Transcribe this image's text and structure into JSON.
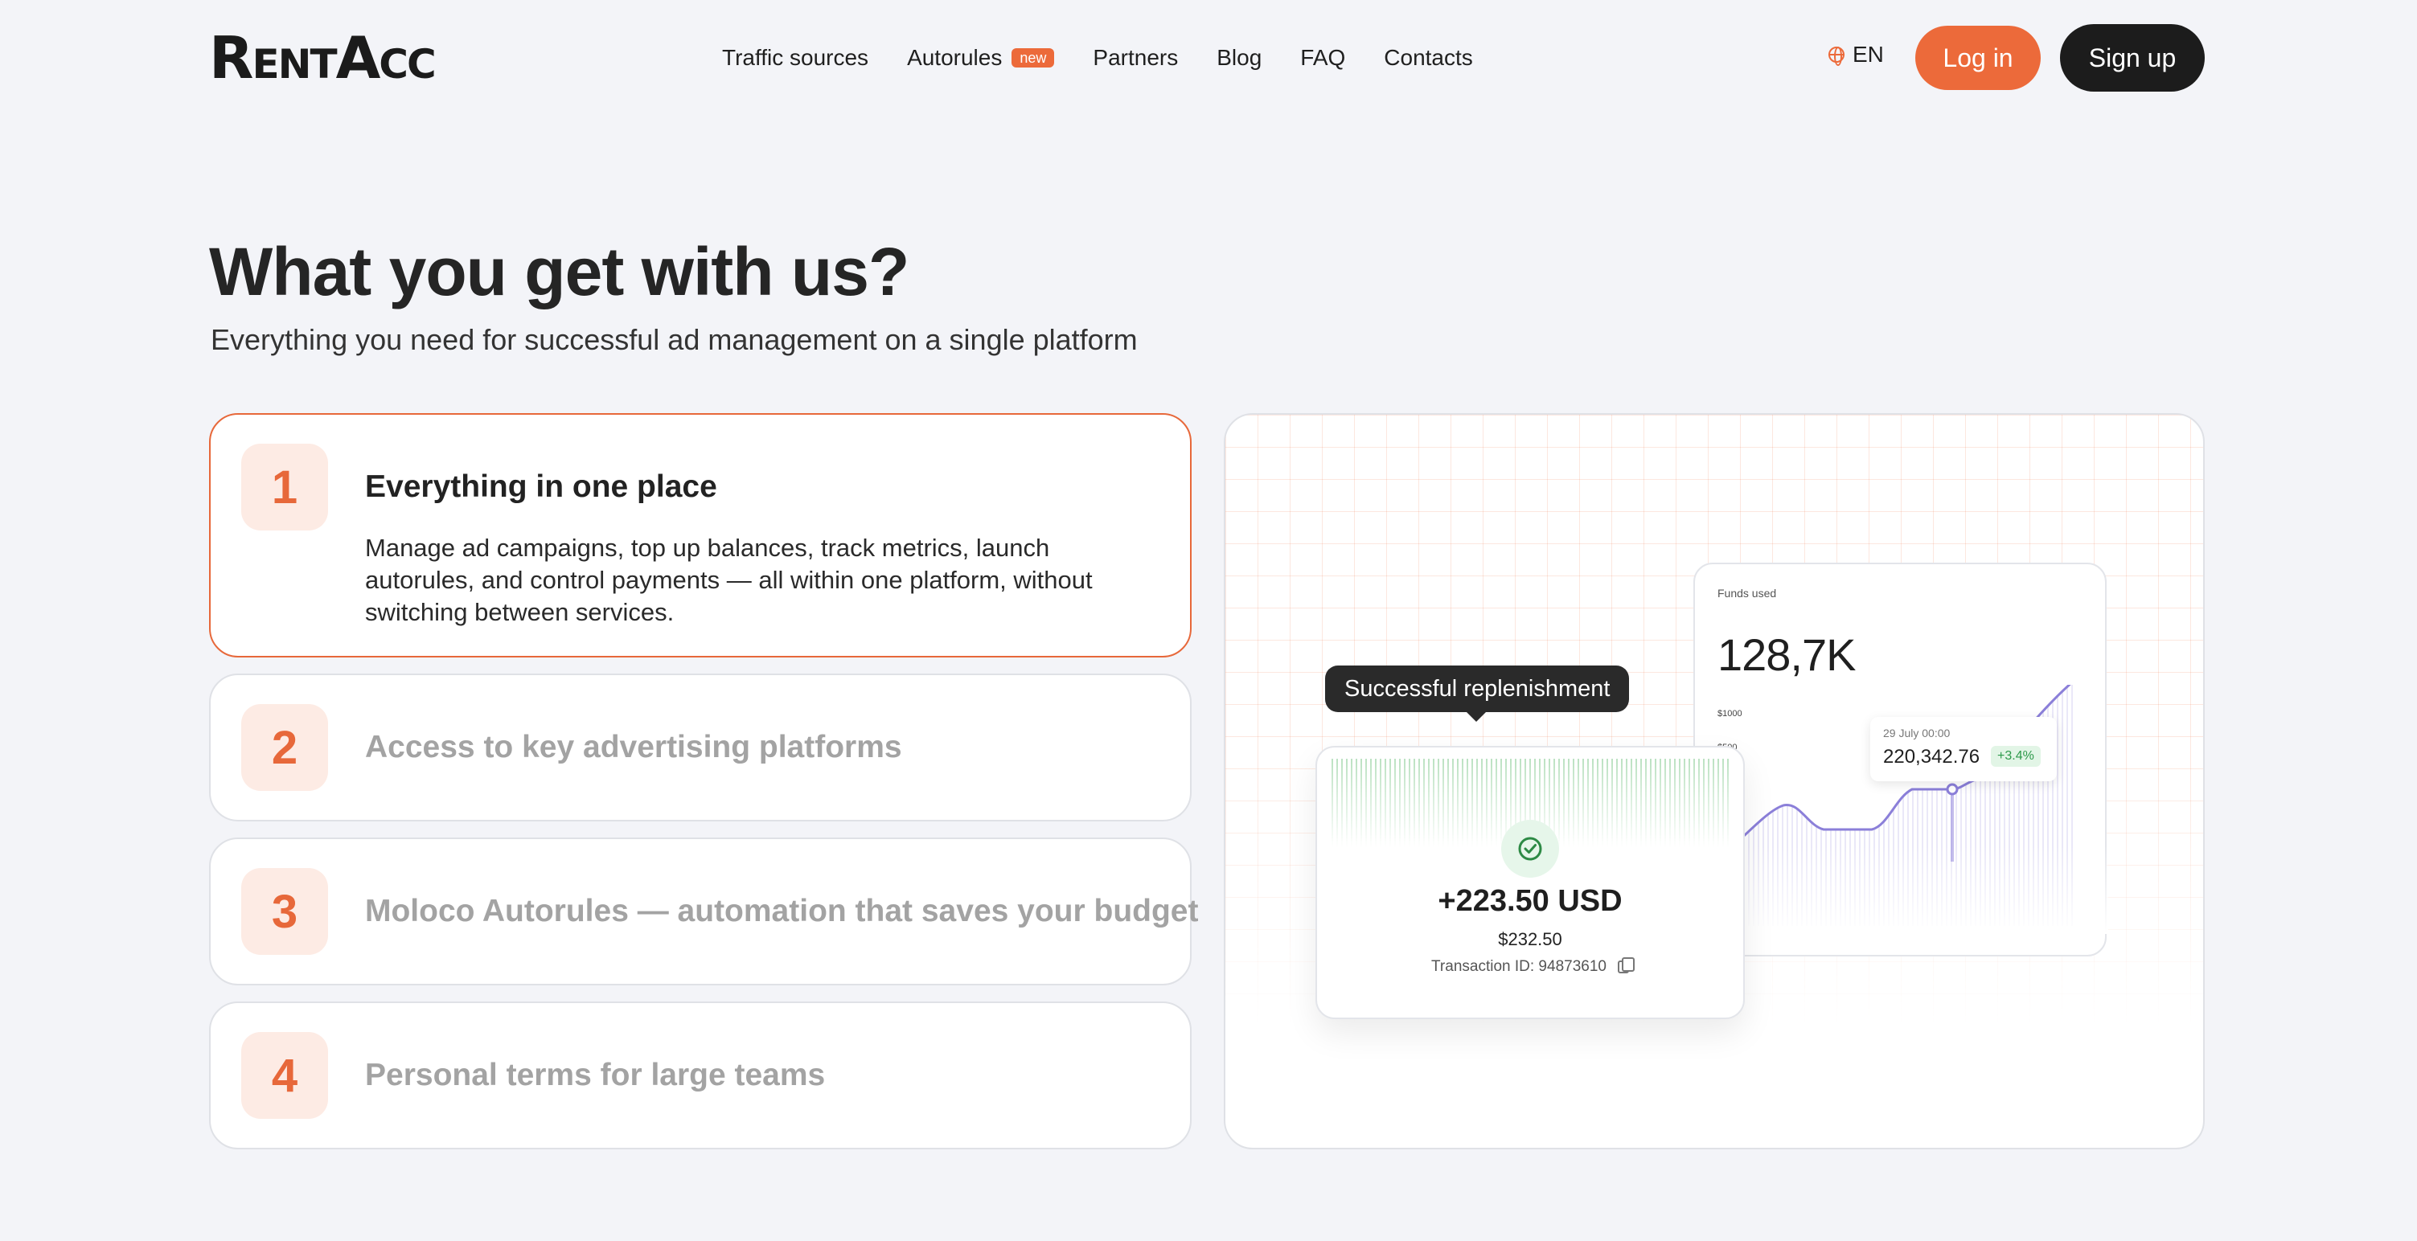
{
  "header": {
    "logo": {
      "first": "R",
      "rest": "ENT",
      "second": "A",
      "tail": "CC"
    },
    "nav": [
      {
        "label": "Traffic sources"
      },
      {
        "label": "Autorules",
        "badge": "new"
      },
      {
        "label": "Partners"
      },
      {
        "label": "Blog"
      },
      {
        "label": "FAQ"
      },
      {
        "label": "Contacts"
      }
    ],
    "language": "EN",
    "login_label": "Log in",
    "signup_label": "Sign up"
  },
  "hero": {
    "title": "What you get with us?",
    "subtitle": "Everything you need for successful ad management on a single platform"
  },
  "features": [
    {
      "number": "1",
      "title": "Everything in one place",
      "description": "Manage ad campaigns, top up balances, track metrics, launch autorules, and control payments — all within one platform, without switching between services.",
      "active": true
    },
    {
      "number": "2",
      "title": "Access to key advertising platforms",
      "active": false
    },
    {
      "number": "3",
      "title": "Moloco Autorules — automation that saves your budget",
      "active": false
    },
    {
      "number": "4",
      "title": "Personal terms for large teams",
      "active": false
    }
  ],
  "illustration": {
    "funds_card": {
      "label": "Funds used",
      "value": "128,7K",
      "y_labels": [
        "$1000",
        "$500"
      ],
      "tooltip": {
        "date": "29 July 00:00",
        "value": "220,342.76",
        "change": "+3.4%"
      }
    },
    "toast": "Successful replenishment",
    "transaction": {
      "amount": "+223.50 USD",
      "secondary": "$232.50",
      "id_text": "Transaction ID: 94873610"
    }
  },
  "colors": {
    "accent": "#ec6a3a",
    "dark": "#1c1c1c",
    "background": "#f3f4f8",
    "chart_line": "#8b7fd9",
    "success": "#2d9a4a"
  },
  "icons": [
    "globe-icon",
    "check-circle-icon",
    "copy-icon"
  ]
}
